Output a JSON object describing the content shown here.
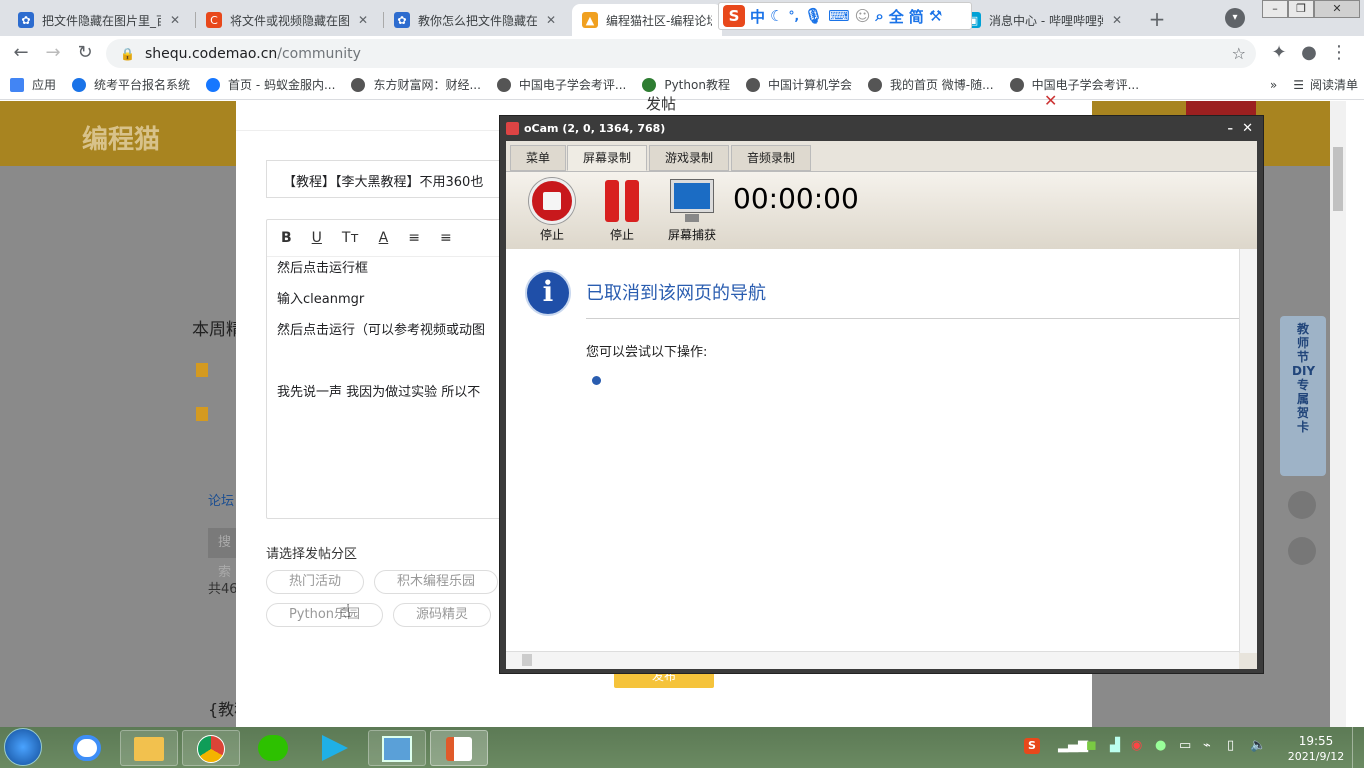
{
  "tabs": [
    {
      "title": "把文件隐藏在图片里_百...",
      "icon_color": "#2d6ccf"
    },
    {
      "title": "将文件或视频隐藏在图...",
      "icon_color": "#e8481b"
    },
    {
      "title": "教你怎么把文件隐藏在...",
      "icon_color": "#2d6ccf"
    },
    {
      "title": "编程猫社区-编程论坛...",
      "icon_color": "#f0a020"
    },
    {
      "title": "消息中心 - 哔哩哔哩弹...",
      "icon_color": "#00a1d6"
    }
  ],
  "ime": {
    "logo": "S",
    "mode": "中",
    "items": [
      "中",
      "☾",
      "°,",
      "⌨",
      "简"
    ]
  },
  "address": {
    "host": "shequ.codemao.cn",
    "path": "/community"
  },
  "bookmarks": [
    {
      "label": "应用",
      "color": "#4285f4"
    },
    {
      "label": "统考平台报名系统",
      "color": "#1a73e8"
    },
    {
      "label": "首页 - 蚂蚁金服内...",
      "color": "#1677ff"
    },
    {
      "label": "东方财富网：财经...",
      "color": "#555555"
    },
    {
      "label": "中国电子学会考评...",
      "color": "#555555"
    },
    {
      "label": "Python教程",
      "color": "#2e7d32"
    },
    {
      "label": "中国计算机学会",
      "color": "#555555"
    },
    {
      "label": "我的首页 微博-随...",
      "color": "#555555"
    },
    {
      "label": "中国电子学会考评...",
      "color": "#555555"
    }
  ],
  "reading_list": "阅读清单",
  "bg_page": {
    "logo": "编程猫",
    "week_label": "本周精",
    "forum_label": "论坛",
    "search_label": "搜索",
    "total_label": "共46",
    "bottom_title": "{教程"
  },
  "post_modal": {
    "header": "发帖",
    "title_value": "【教程】【李大黑教程】不用360也",
    "toolbar": [
      "B",
      "U",
      "Tт",
      "A",
      "≡",
      "≡"
    ],
    "body_lines": [
      "然后点击运行框",
      "输入cleanmgr",
      "然后点击运行（可以参考视频或动图",
      "",
      "我先说一声   我因为做过实验  所以不"
    ],
    "section_label": "请选择发帖分区",
    "chips": [
      "热门活动",
      "积木编程乐园",
      "Python乐园",
      "源码精灵"
    ],
    "submit_label": "发布"
  },
  "side_banner": {
    "text": "教师节DIY专属贺卡"
  },
  "ocam": {
    "title": "oCam (2, 0, 1364, 768)",
    "tabs": [
      "菜单",
      "屏幕录制",
      "游戏录制",
      "音频录制"
    ],
    "buttons": [
      {
        "label": "停止",
        "icon": "record-stop-icon"
      },
      {
        "label": "停止",
        "icon": "pause-icon"
      },
      {
        "label": "屏幕捕获",
        "icon": "monitor-icon"
      }
    ],
    "timer": "00:00:00",
    "content_heading": "已取消到该网页的导航",
    "content_sub": "您可以尝试以下操作:"
  },
  "taskbar": {
    "time": "19:55",
    "date": "2021/9/12"
  }
}
